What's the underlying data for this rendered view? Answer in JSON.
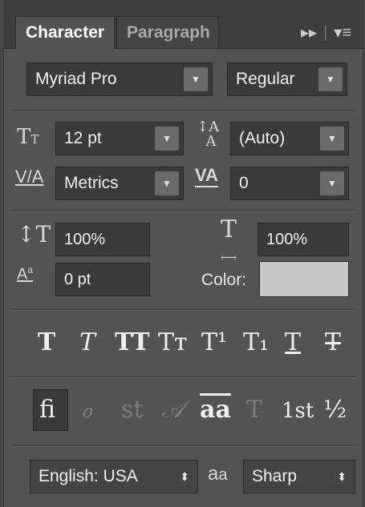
{
  "tabs": [
    {
      "label": "Character",
      "active": true
    },
    {
      "label": "Paragraph",
      "active": false
    }
  ],
  "toolbar": {
    "expand_icon": "double-chevron-right-icon",
    "menu_icon": "panel-menu-icon"
  },
  "font": {
    "family": "Myriad Pro",
    "style": "Regular"
  },
  "size": {
    "value": "12 pt",
    "leading": "(Auto)"
  },
  "kerning": {
    "value": "Metrics",
    "tracking": "0"
  },
  "scale": {
    "vertical": "100%",
    "horizontal": "100%"
  },
  "baseline": {
    "shift": "0 pt"
  },
  "color": {
    "label": "Color:",
    "swatch": "#c8c8c8"
  },
  "format_buttons": [
    {
      "name": "faux-bold",
      "glyph": "T"
    },
    {
      "name": "faux-italic",
      "glyph": "T"
    },
    {
      "name": "all-caps",
      "glyph": "TT"
    },
    {
      "name": "small-caps",
      "glyph": "Tт"
    },
    {
      "name": "superscript",
      "glyph": "T¹"
    },
    {
      "name": "subscript",
      "glyph": "T₁"
    },
    {
      "name": "underline",
      "glyph": "T"
    },
    {
      "name": "strikethrough",
      "glyph": "T"
    }
  ],
  "opentype_buttons": [
    {
      "name": "standard-ligatures",
      "glyph": "fi",
      "active": true
    },
    {
      "name": "contextual-alternates",
      "glyph": "ℴ",
      "active": false
    },
    {
      "name": "discretionary-ligatures",
      "glyph": "st",
      "active": false
    },
    {
      "name": "swash",
      "glyph": "𝒜",
      "active": false
    },
    {
      "name": "stylistic-alternates",
      "glyph": "aa",
      "active": true
    },
    {
      "name": "titling-alternates",
      "glyph": "T",
      "active": false
    },
    {
      "name": "ordinals",
      "glyph": "1st",
      "active": true
    },
    {
      "name": "fractions",
      "glyph": "½",
      "active": true
    }
  ],
  "language": {
    "value": "English: USA"
  },
  "antialias": {
    "value": "Sharp"
  }
}
